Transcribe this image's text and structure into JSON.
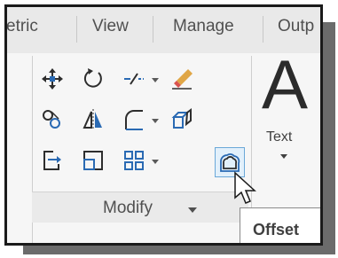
{
  "ribbon": {
    "tabs": [
      {
        "label": "etric"
      },
      {
        "label": "View"
      },
      {
        "label": "Manage"
      },
      {
        "label": "Outp"
      }
    ]
  },
  "modify_panel": {
    "label": "Modify",
    "tools": [
      {
        "icon": "move-icon"
      },
      {
        "icon": "rotate-icon"
      },
      {
        "icon": "trim-icon"
      },
      {
        "icon": "erase-icon"
      },
      {
        "icon": "copy-icon"
      },
      {
        "icon": "mirror-icon"
      },
      {
        "icon": "fillet-icon"
      },
      {
        "icon": "explode-icon"
      },
      {
        "icon": "stretch-icon"
      },
      {
        "icon": "scale-icon"
      },
      {
        "icon": "array-icon"
      },
      {
        "icon": "offset-icon"
      }
    ]
  },
  "text_panel": {
    "big_letter": "A",
    "label": "Text"
  },
  "tooltip": {
    "text": "Offset"
  },
  "colors": {
    "highlight": "#e2f0fb",
    "highlight_border": "#6aa8d8",
    "icon_blue": "#2a6ab3"
  }
}
